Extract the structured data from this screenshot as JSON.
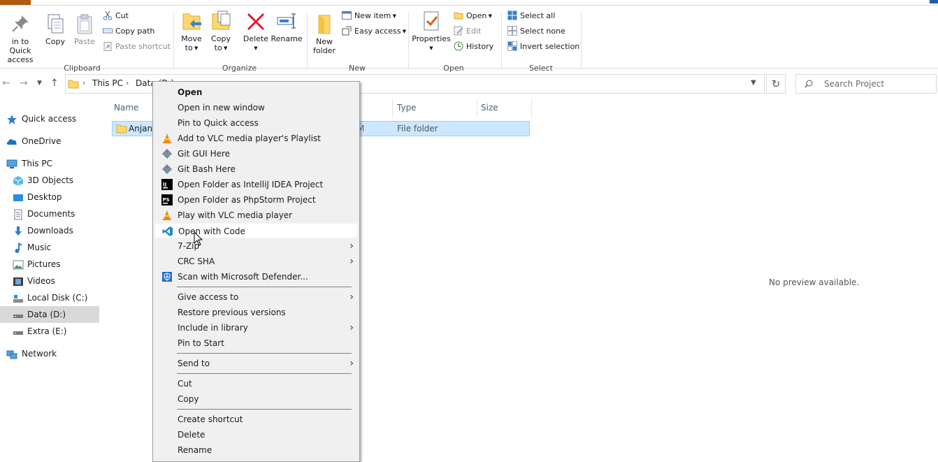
{
  "ribbon": {
    "clipboard": {
      "pin_label_1": "in to Quick",
      "pin_label_2": "access",
      "copy": "Copy",
      "paste": "Paste",
      "cut": "Cut",
      "copy_path": "Copy path",
      "paste_shortcut": "Paste shortcut",
      "group": "Clipboard"
    },
    "organize": {
      "move_to_1": "Move",
      "move_to_2": "to",
      "copy_to_1": "Copy",
      "copy_to_2": "to",
      "delete": "Delete",
      "rename": "Rename",
      "group": "Organize"
    },
    "new": {
      "new_folder_1": "New",
      "new_folder_2": "folder",
      "new_item": "New item",
      "easy_access": "Easy access",
      "group": "New"
    },
    "open": {
      "properties": "Properties",
      "open": "Open",
      "edit": "Edit",
      "history": "History",
      "group": "Open"
    },
    "select": {
      "select_all": "Select all",
      "select_none": "Select none",
      "invert_selection": "Invert selection",
      "group": "Select"
    }
  },
  "address": {
    "crumb1": "This PC",
    "crumb2": "Data (D:)",
    "search_placeholder": "Search Project"
  },
  "nav": {
    "quick_access": "Quick access",
    "onedrive": "OneDrive",
    "this_pc": "This PC",
    "objects3d": "3D Objects",
    "desktop": "Desktop",
    "documents": "Documents",
    "downloads": "Downloads",
    "music": "Music",
    "pictures": "Pictures",
    "videos": "Videos",
    "local_disk": "Local Disk (C:)",
    "data_d": "Data (D:)",
    "extra_e": "Extra (E:)",
    "network": "Network"
  },
  "content": {
    "col_name": "Name",
    "col_type": "Type",
    "col_size": "Size",
    "row_name": "Anjana",
    "row_date_fragment": "M",
    "row_type": "File folder",
    "no_preview": "No preview available."
  },
  "context_menu": {
    "open": "Open",
    "open_new_window": "Open in new window",
    "pin_quick_access": "Pin to Quick access",
    "vlc_playlist": "Add to VLC media player's Playlist",
    "git_gui": "Git GUI Here",
    "git_bash": "Git Bash Here",
    "intellij": "Open Folder as IntelliJ IDEA Project",
    "phpstorm": "Open Folder as PhpStorm Project",
    "vlc_play": "Play with VLC media player",
    "vscode": "Open with Code",
    "zip7": "7-Zip",
    "crc_sha": "CRC SHA",
    "defender": "Scan with Microsoft Defender...",
    "give_access": "Give access to",
    "restore_versions": "Restore previous versions",
    "include_library": "Include in library",
    "pin_start": "Pin to Start",
    "send_to": "Send to",
    "cut": "Cut",
    "copy": "Copy",
    "create_shortcut": "Create shortcut",
    "delete": "Delete",
    "rename": "Rename"
  },
  "colors": {
    "folder": "#ffd86b",
    "selection": "#cce8ff",
    "delete_red": "#e81123",
    "vscode_blue": "#1a8ad4",
    "vlc_orange": "#f08c00"
  }
}
